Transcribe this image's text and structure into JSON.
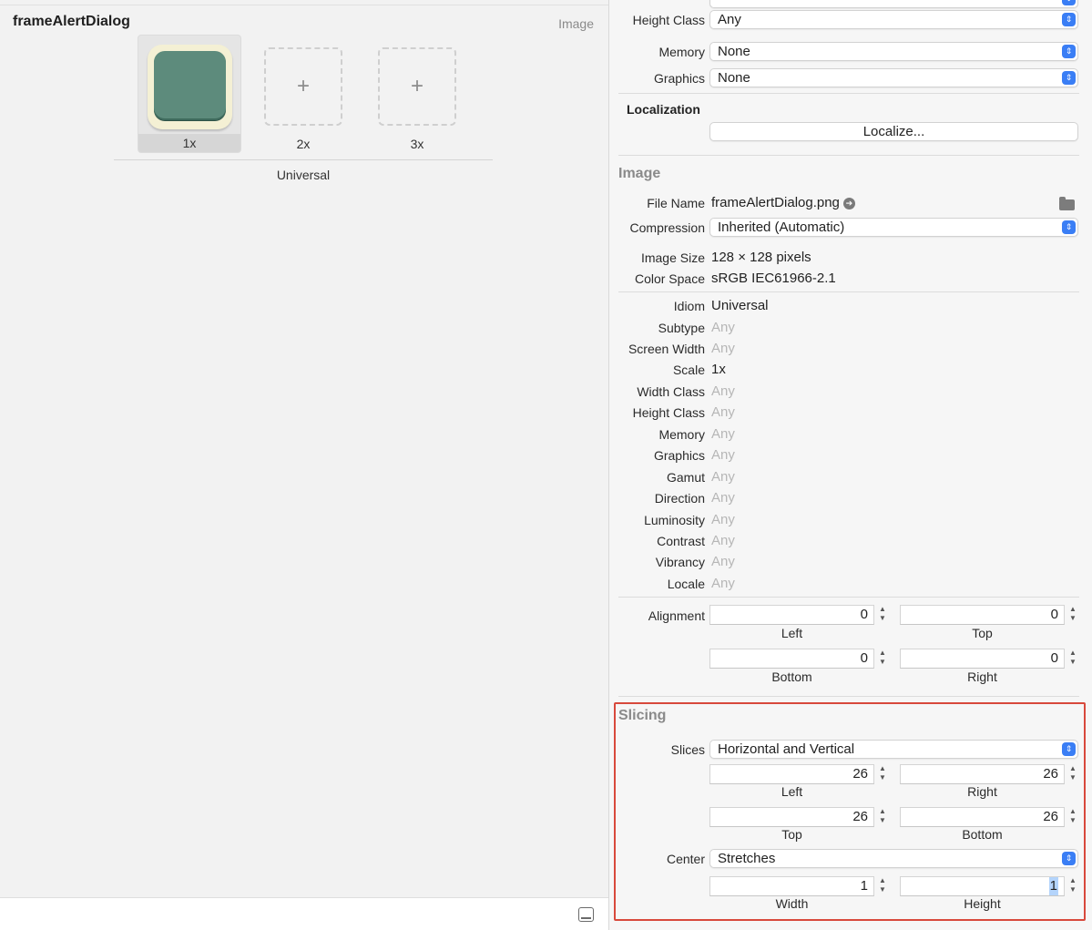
{
  "asset": {
    "title": "frameAlertDialog",
    "type": "Image",
    "slots": [
      {
        "label": "1x",
        "filled": true
      },
      {
        "label": "2x",
        "filled": false,
        "plus": "+"
      },
      {
        "label": "3x",
        "filled": false,
        "plus": "+"
      }
    ],
    "group_label": "Universal"
  },
  "device_attributes": {
    "height_class": {
      "label": "Height Class",
      "value": "Any"
    },
    "memory": {
      "label": "Memory",
      "value": "None"
    },
    "graphics": {
      "label": "Graphics",
      "value": "None"
    }
  },
  "localization": {
    "title": "Localization",
    "button": "Localize..."
  },
  "image": {
    "section_title": "Image",
    "file_name": {
      "label": "File Name",
      "value": "frameAlertDialog.png",
      "goto_icon": "➔"
    },
    "compression": {
      "label": "Compression",
      "value": "Inherited (Automatic)"
    },
    "image_size": {
      "label": "Image Size",
      "value": "128 × 128 pixels"
    },
    "color_space": {
      "label": "Color Space",
      "value": "sRGB IEC61966-2.1"
    },
    "idiom": {
      "label": "Idiom",
      "value": "Universal"
    },
    "subtype": {
      "label": "Subtype",
      "value": "Any"
    },
    "screen_width": {
      "label": "Screen Width",
      "value": "Any"
    },
    "scale": {
      "label": "Scale",
      "value": "1x"
    },
    "width_class": {
      "label": "Width Class",
      "value": "Any"
    },
    "height_class": {
      "label": "Height Class",
      "value": "Any"
    },
    "memory": {
      "label": "Memory",
      "value": "Any"
    },
    "graphics": {
      "label": "Graphics",
      "value": "Any"
    },
    "gamut": {
      "label": "Gamut",
      "value": "Any"
    },
    "direction": {
      "label": "Direction",
      "value": "Any"
    },
    "luminosity": {
      "label": "Luminosity",
      "value": "Any"
    },
    "contrast": {
      "label": "Contrast",
      "value": "Any"
    },
    "vibrancy": {
      "label": "Vibrancy",
      "value": "Any"
    },
    "locale": {
      "label": "Locale",
      "value": "Any"
    }
  },
  "alignment": {
    "label": "Alignment",
    "left": {
      "label": "Left",
      "value": "0"
    },
    "top": {
      "label": "Top",
      "value": "0"
    },
    "bottom": {
      "label": "Bottom",
      "value": "0"
    },
    "right": {
      "label": "Right",
      "value": "0"
    }
  },
  "slicing": {
    "section_title": "Slicing",
    "slices": {
      "label": "Slices",
      "value": "Horizontal and Vertical"
    },
    "left": {
      "label": "Left",
      "value": "26"
    },
    "right": {
      "label": "Right",
      "value": "26"
    },
    "top": {
      "label": "Top",
      "value": "26"
    },
    "bottom": {
      "label": "Bottom",
      "value": "26"
    },
    "center": {
      "label": "Center",
      "value": "Stretches"
    },
    "width": {
      "label": "Width",
      "value": "1"
    },
    "height": {
      "label": "Height",
      "value": "1"
    }
  },
  "stepper_glyphs": {
    "up": "▲",
    "down": "▼"
  },
  "popup_glyph": "⇕",
  "colors": {
    "accent": "#3a7ef5",
    "highlight": "#d8493c",
    "thumb_frame": "#f4f0d4",
    "thumb_fill": "#5d8b7c"
  }
}
